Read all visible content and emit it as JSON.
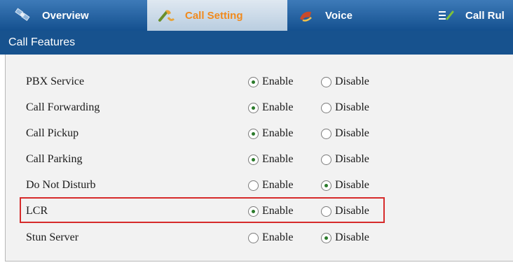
{
  "tabs": [
    {
      "label": "Overview",
      "icon": "satellite-icon",
      "active": false
    },
    {
      "label": "Call Setting",
      "icon": "phone-wrench-icon",
      "active": true
    },
    {
      "label": "Voice",
      "icon": "voice-speaker-icon",
      "active": false
    },
    {
      "label": "Call Rul",
      "icon": "call-rules-icon",
      "active": false
    }
  ],
  "section": {
    "title": "Call Features"
  },
  "options": {
    "enable": "Enable",
    "disable": "Disable"
  },
  "features": [
    {
      "label": "PBX Service",
      "selected": "enable"
    },
    {
      "label": "Call Forwarding",
      "selected": "enable"
    },
    {
      "label": "Call Pickup",
      "selected": "enable"
    },
    {
      "label": "Call Parking",
      "selected": "enable"
    },
    {
      "label": "Do Not Disturb",
      "selected": "disable"
    },
    {
      "label": "LCR",
      "selected": "enable",
      "highlighted": true
    },
    {
      "label": "Stun Server",
      "selected": "disable"
    }
  ],
  "colors": {
    "tab_bar": "#1f5a97",
    "active_tab_text": "#f08a1e",
    "section_header": "#17528e",
    "highlight": "#d62b2b",
    "radio_dot": "#2a7a2a"
  }
}
